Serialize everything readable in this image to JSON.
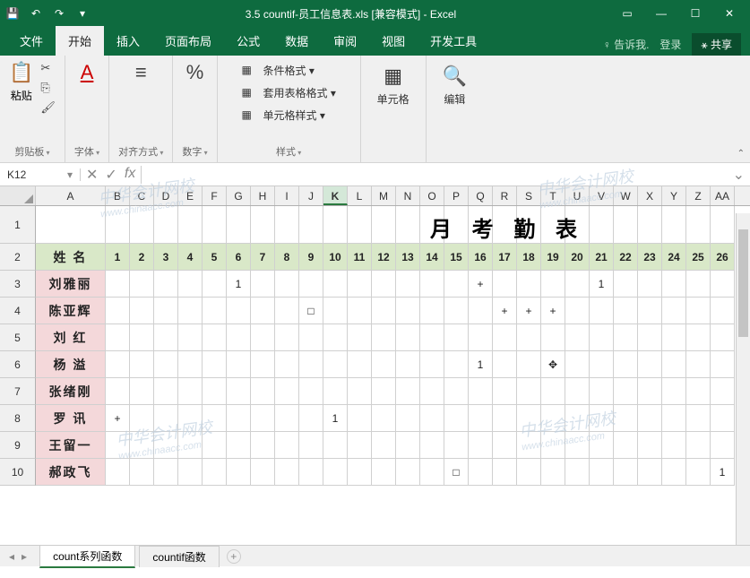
{
  "titlebar": {
    "title": "3.5 countif-员工信息表.xls [兼容模式] - Excel"
  },
  "tabs": {
    "items": [
      "文件",
      "开始",
      "插入",
      "页面布局",
      "公式",
      "数据",
      "审阅",
      "视图",
      "开发工具"
    ],
    "active": 1,
    "tell_me": "告诉我.",
    "signin": "登录",
    "share": "共享"
  },
  "ribbon": {
    "clipboard": {
      "label": "剪贴板",
      "paste": "粘贴"
    },
    "font": {
      "label": "字体",
      "sample": "A"
    },
    "align": {
      "label": "对齐方式"
    },
    "number": {
      "label": "数字",
      "sample": "%"
    },
    "styles": {
      "label": "样式",
      "conditional": "条件格式 ▾",
      "table": "套用表格格式 ▾",
      "cell": "单元格样式 ▾"
    },
    "cells": {
      "label": "单元格"
    },
    "editing": {
      "label": "编辑"
    }
  },
  "formula_bar": {
    "name_box": "K12",
    "fx": "fx",
    "value": ""
  },
  "chart_data": {
    "type": "table",
    "title": "月 考 勤 表",
    "columns": [
      "A",
      "B",
      "C",
      "D",
      "E",
      "F",
      "G",
      "H",
      "I",
      "J",
      "K",
      "L",
      "M",
      "N",
      "O",
      "P",
      "Q",
      "R",
      "S",
      "T",
      "U",
      "V",
      "W",
      "X",
      "Y",
      "Z",
      "AA"
    ],
    "active_column": "K",
    "header_row": [
      "姓 名",
      "1",
      "2",
      "3",
      "4",
      "5",
      "6",
      "7",
      "8",
      "9",
      "10",
      "11",
      "12",
      "13",
      "14",
      "15",
      "16",
      "17",
      "18",
      "19",
      "20",
      "21",
      "22",
      "23",
      "24",
      "25",
      "26"
    ],
    "rows": [
      {
        "name": "刘雅丽",
        "cells": [
          "",
          "",
          "",
          "",
          "",
          "1",
          "",
          "",
          "",
          "",
          "",
          "",
          "",
          "",
          "",
          "+",
          "",
          "",
          "",
          "",
          "1",
          "",
          "",
          "",
          "",
          ""
        ]
      },
      {
        "name": "陈亚辉",
        "cells": [
          "",
          "",
          "",
          "",
          "",
          "",
          "",
          "",
          "□",
          "",
          "",
          "",
          "",
          "",
          "",
          "",
          "+",
          "+",
          "+",
          "",
          "",
          "",
          "",
          "",
          "",
          ""
        ]
      },
      {
        "name": "刘 红",
        "cells": [
          "",
          "",
          "",
          "",
          "",
          "",
          "",
          "",
          "",
          "",
          "",
          "",
          "",
          "",
          "",
          "",
          "",
          "",
          "",
          "",
          "",
          "",
          "",
          "",
          "",
          ""
        ]
      },
      {
        "name": "杨 溢",
        "cells": [
          "",
          "",
          "",
          "",
          "",
          "",
          "",
          "",
          "",
          "",
          "",
          "",
          "",
          "",
          "",
          "1",
          "",
          "",
          "✥",
          "",
          "",
          "",
          "",
          "",
          "",
          ""
        ]
      },
      {
        "name": "张绪刚",
        "cells": [
          "",
          "",
          "",
          "",
          "",
          "",
          "",
          "",
          "",
          "",
          "",
          "",
          "",
          "",
          "",
          "",
          "",
          "",
          "",
          "",
          "",
          "",
          "",
          "",
          "",
          ""
        ]
      },
      {
        "name": "罗 讯",
        "cells": [
          "+",
          "",
          "",
          "",
          "",
          "",
          "",
          "",
          "",
          "1",
          "",
          "",
          "",
          "",
          "",
          "",
          "",
          "",
          "",
          "",
          "",
          "",
          "",
          "",
          "",
          ""
        ]
      },
      {
        "name": "王留一",
        "cells": [
          "",
          "",
          "",
          "",
          "",
          "",
          "",
          "",
          "",
          "",
          "",
          "",
          "",
          "",
          "",
          "",
          "",
          "",
          "",
          "",
          "",
          "",
          "",
          "",
          "",
          ""
        ]
      },
      {
        "name": "郝政飞",
        "cells": [
          "",
          "",
          "",
          "",
          "",
          "",
          "",
          "",
          "",
          "",
          "",
          "",
          "",
          "",
          "□",
          "",
          "",
          "",
          "",
          "",
          "",
          "",
          "",
          "",
          "",
          "1"
        ]
      }
    ],
    "selected_cell": "K12"
  },
  "sheet_tabs": {
    "tabs": [
      "count系列函数",
      "countif函数"
    ],
    "active": 0
  },
  "watermark": {
    "text": "中华会计网校",
    "url": "www.chinaacc.com"
  }
}
